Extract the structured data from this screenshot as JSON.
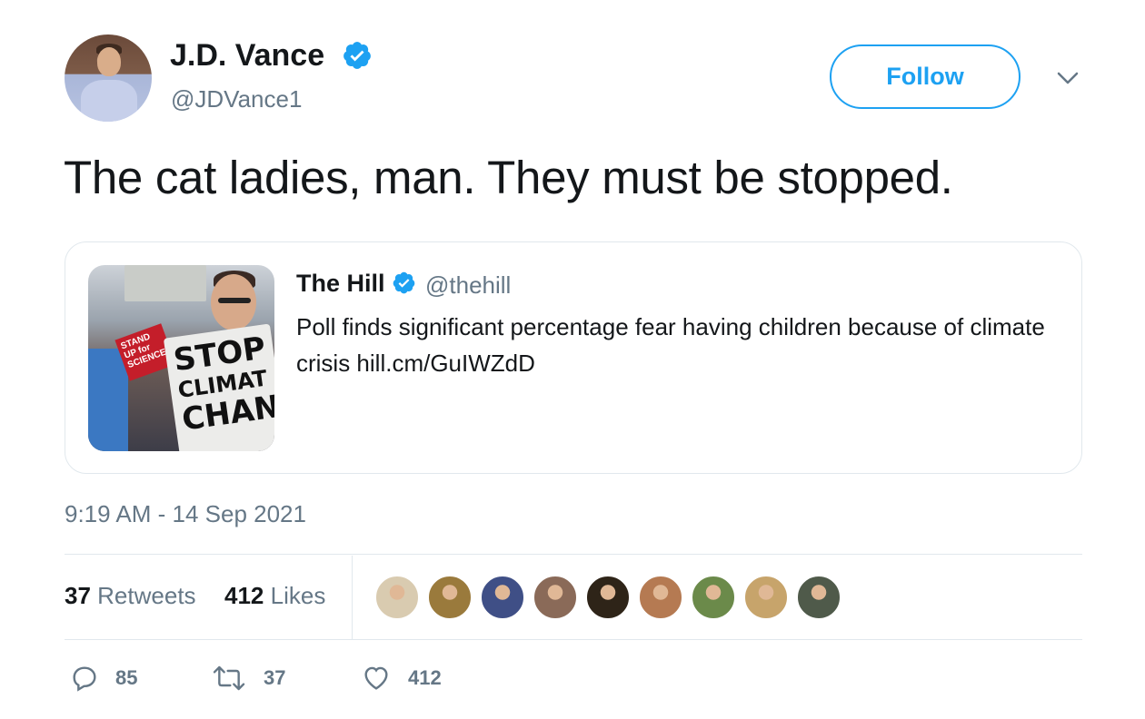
{
  "author": {
    "name": "J.D. Vance",
    "handle": "@JDVance1",
    "verified": true
  },
  "follow_label": "Follow",
  "tweet": {
    "text": "The cat ladies, man. They must be stopped.",
    "timestamp": "9:19 AM - 14 Sep 2021"
  },
  "quoted": {
    "name": "The Hill",
    "handle": "@thehill",
    "text": "Poll finds significant percentage fear having children because of climate crisis hill.cm/GuIWZdD",
    "image_sign": {
      "main_line1": "STOP",
      "main_line2": "CLIMAT",
      "main_line3": "CHAN",
      "red_sign": "STAND UP for SCIENCE"
    }
  },
  "stats": {
    "retweets_count": "37",
    "retweets_label": "Retweets",
    "likes_count": "412",
    "likes_label": "Likes"
  },
  "likers": [
    {
      "color": "#d9cbb0"
    },
    {
      "color": "#9a7a3c"
    },
    {
      "color": "#3f4f86"
    },
    {
      "color": "#8a6a58"
    },
    {
      "color": "#2e2418"
    },
    {
      "color": "#b57a52"
    },
    {
      "color": "#6b8a4a"
    },
    {
      "color": "#c7a46b"
    },
    {
      "color": "#4f5a4a"
    }
  ],
  "actions": {
    "reply_count": "85",
    "retweet_count": "37",
    "like_count": "412"
  },
  "colors": {
    "accent": "#1da1f2",
    "secondary_text": "#657786",
    "border": "#e1e8ed"
  },
  "icons": [
    "verified-badge-icon",
    "chevron-down-icon",
    "reply-icon",
    "retweet-icon",
    "heart-icon"
  ]
}
